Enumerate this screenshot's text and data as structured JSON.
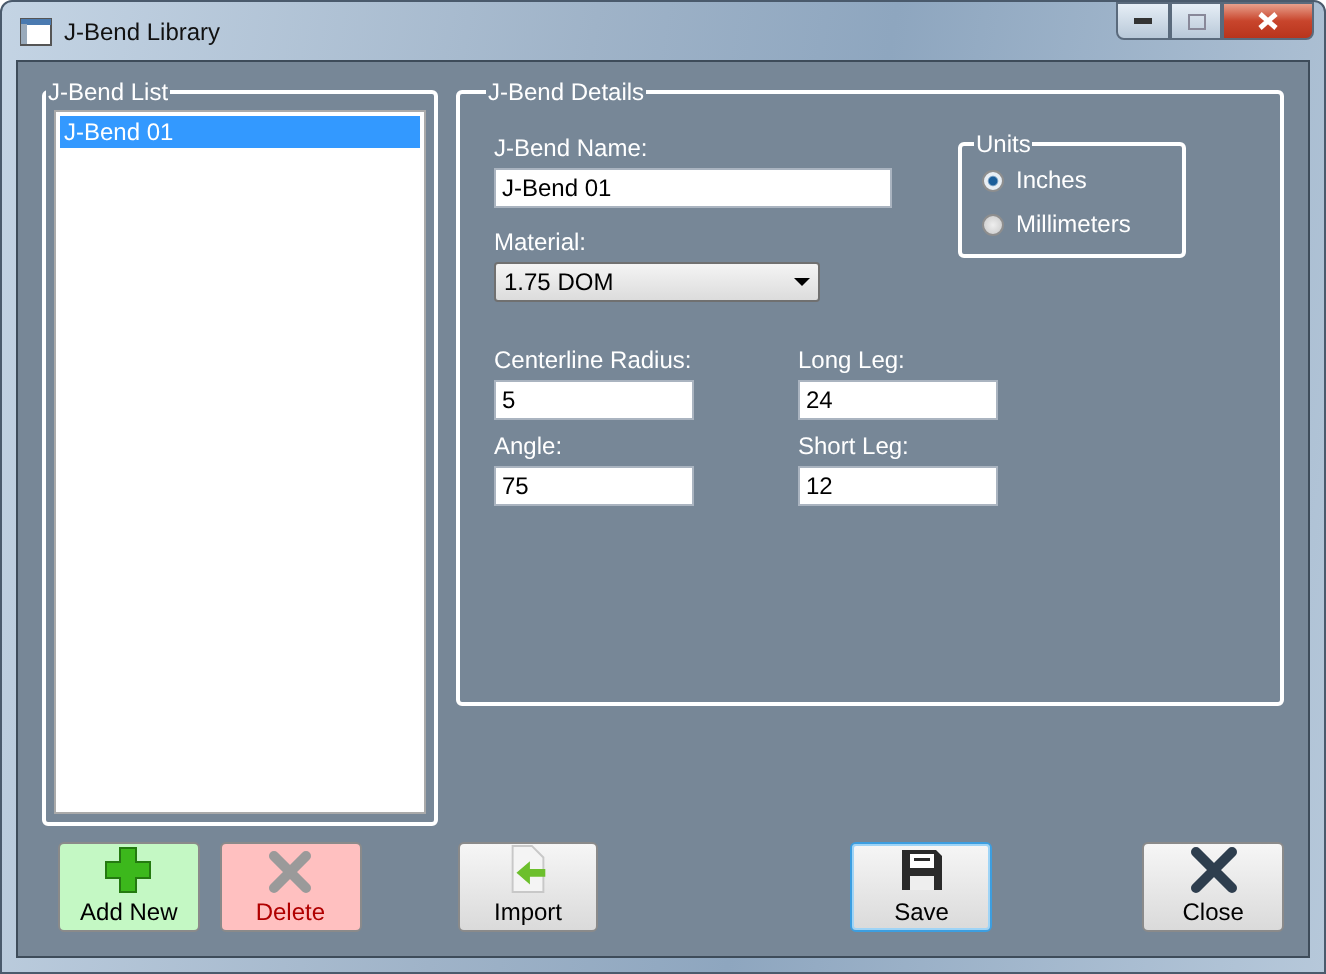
{
  "window": {
    "title": "J-Bend Library"
  },
  "list_group": {
    "title": "J-Bend List",
    "items": [
      {
        "label": "J-Bend 01",
        "selected": true
      }
    ]
  },
  "details_group": {
    "title": "J-Bend Details",
    "name": {
      "label": "J-Bend Name:",
      "value": "J-Bend 01"
    },
    "material": {
      "label": "Material:",
      "value": "1.75 DOM"
    },
    "units": {
      "title": "Units",
      "options": [
        {
          "label": "Inches",
          "selected": true
        },
        {
          "label": "Millimeters",
          "selected": false
        }
      ]
    },
    "fields": [
      {
        "label": "Centerline Radius:",
        "value": "5"
      },
      {
        "label": "Long Leg:",
        "value": "24"
      },
      {
        "label": "Angle:",
        "value": "75"
      },
      {
        "label": "Short Leg:",
        "value": "12"
      }
    ]
  },
  "buttons": [
    {
      "label": "Add New",
      "kind": "add",
      "focused": false
    },
    {
      "label": "Delete",
      "kind": "delete",
      "focused": false
    },
    {
      "label": "Import",
      "kind": "import",
      "focused": false
    },
    {
      "label": "Save",
      "kind": "save",
      "focused": true
    },
    {
      "label": "Close",
      "kind": "close",
      "focused": false
    }
  ]
}
